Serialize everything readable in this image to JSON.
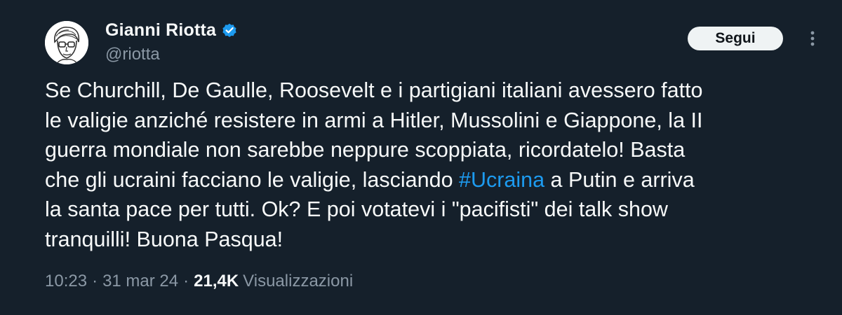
{
  "author": {
    "display_name": "Gianni Riotta",
    "handle": "@riotta",
    "verified": true,
    "avatar_icon": "caricature-portrait-avatar"
  },
  "actions": {
    "follow_label": "Segui",
    "more_icon": "vertical-ellipsis-icon"
  },
  "tweet": {
    "lines": [
      "Se Churchill, De Gaulle, Roosevelt e i partigiani italiani avessero fatto",
      "le valigie anziché resistere in armi a Hitler, Mussolini e Giappone, la II",
      "guerra mondiale non sarebbe neppure scoppiata, ricordatelo! Basta",
      "che gli ucraini facciano le valigie, lasciando ",
      "la santa pace per tutti. Ok? E poi votatevi i \"pacifisti\" dei talk show",
      "tranquilli! Buona Pasqua!"
    ],
    "hashtag": "#Ucraina",
    "line4_after_hashtag": " a Putin e arriva"
  },
  "meta": {
    "time": "10:23",
    "separator": "·",
    "date": "31 mar 24",
    "views_count": "21,4K",
    "views_label": "Visualizzazioni"
  },
  "colors": {
    "background": "#15202b",
    "text": "#f7f9f9",
    "secondary_text": "#8b98a5",
    "link": "#1d9bf0",
    "verified_badge": "#1d9bf0",
    "follow_button_bg": "#eff3f4"
  }
}
